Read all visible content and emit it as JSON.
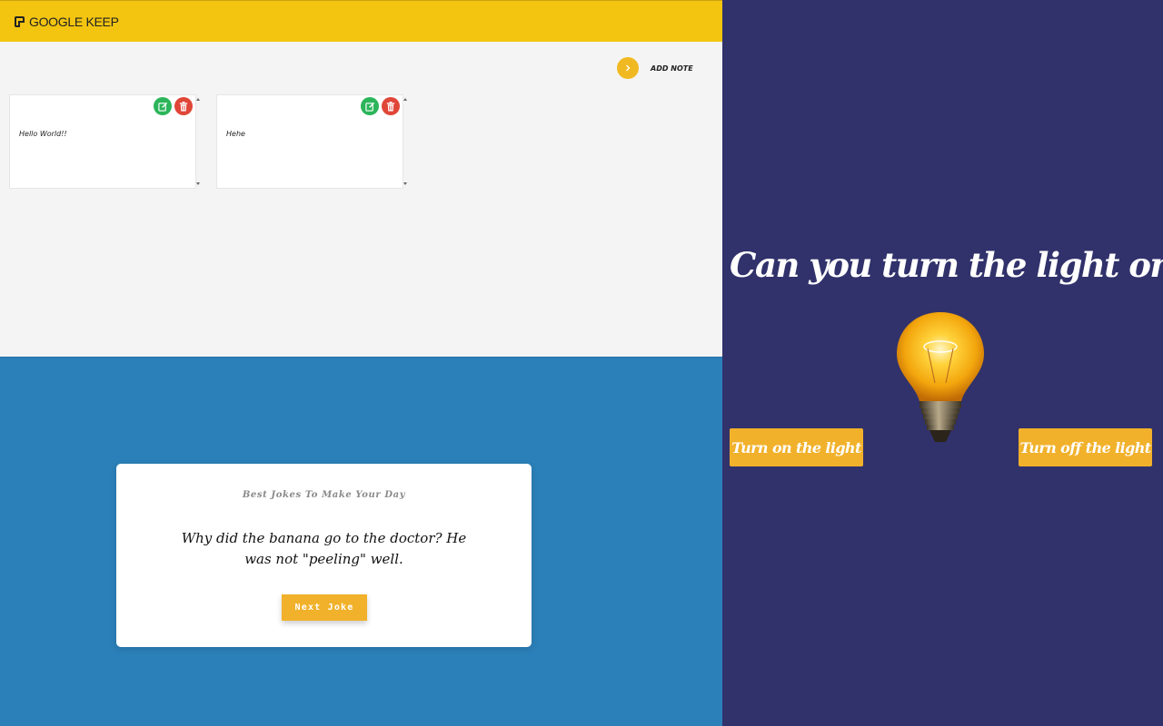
{
  "keep": {
    "logo_text": "GOOGLE KEEP",
    "add_note_label": "ADD NOTE",
    "notes": [
      {
        "text": "Hello World!!"
      },
      {
        "text": "Hehe"
      }
    ],
    "colors": {
      "header": "#f3c511",
      "accent": "#f1b921",
      "edit": "#2bb55a",
      "delete": "#e04638"
    }
  },
  "jokes": {
    "heading": "Best Jokes To Make Your Day",
    "joke": "Why did the banana go to the doctor? He was not \"peeling\" well.",
    "next_label": "Next Joke",
    "colors": {
      "background": "#2b80b9",
      "button": "#f1b12b"
    }
  },
  "light": {
    "title": "Can you turn the light on?",
    "on_label": "Turn on the light",
    "off_label": "Turn off the light",
    "bulb_state": "on",
    "colors": {
      "background": "#31326b",
      "button": "#f1b12b"
    }
  }
}
